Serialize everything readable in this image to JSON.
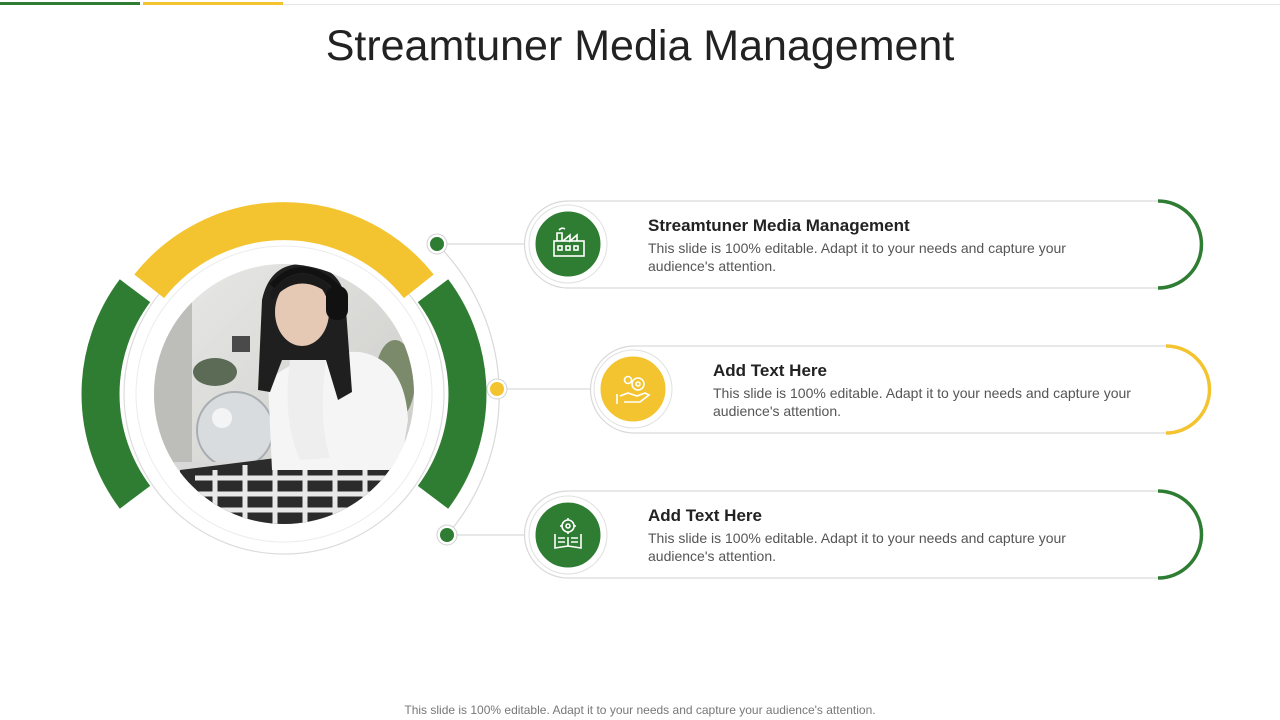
{
  "title": "Streamtuner Media Management",
  "items": [
    {
      "heading": "Streamtuner Media Management",
      "body": "This slide is 100% editable. Adapt it to your needs and capture your audience's attention.",
      "icon": "factory-icon",
      "color": "#2e7d32"
    },
    {
      "heading": "Add Text Here",
      "body": "This slide is 100% editable. Adapt it to your needs and capture your audience's attention.",
      "icon": "hand-money-icon",
      "color": "#f4c430"
    },
    {
      "heading": "Add Text Here",
      "body": "This slide is 100% editable. Adapt it to your needs and capture your audience's attention.",
      "icon": "book-gear-icon",
      "color": "#2e7d32"
    }
  ],
  "footer": "This slide is 100% editable. Adapt it to your needs and capture your audience's attention.",
  "colors": {
    "green": "#2e7d32",
    "yellow": "#f4c430"
  }
}
